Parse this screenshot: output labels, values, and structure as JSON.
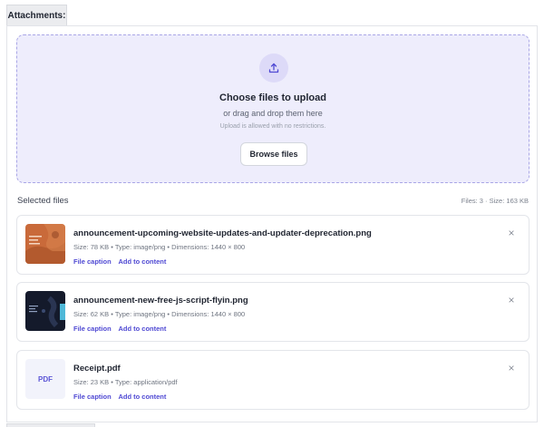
{
  "tab": {
    "label": "Attachments:"
  },
  "dropzone": {
    "icon": "upload-icon",
    "title": "Choose files to upload",
    "subtitle": "or drag and drop them here",
    "note": "Upload is allowed with no restrictions.",
    "browse_label": "Browse files"
  },
  "selected": {
    "title": "Selected files",
    "stats": "Files: 3 · Size: 163 KB"
  },
  "files": [
    {
      "name": "announcement-upcoming-website-updates-and-updater-deprecation.png",
      "meta": "Size: 78 KB • Type: image/png • Dimensions: 1440 × 800",
      "caption_label": "File caption",
      "add_label": "Add to content",
      "close_label": "×",
      "thumb": "image-thumbnail-orange"
    },
    {
      "name": "announcement-new-free-js-script-flyin.png",
      "meta": "Size: 62 KB • Type: image/png • Dimensions: 1440 × 800",
      "caption_label": "File caption",
      "add_label": "Add to content",
      "close_label": "×",
      "thumb": "image-thumbnail-dark"
    },
    {
      "name": "Receipt.pdf",
      "meta": "Size: 23 KB • Type: application/pdf",
      "caption_label": "File caption",
      "add_label": "Add to content",
      "close_label": "×",
      "thumb_label": "PDF"
    }
  ],
  "colors": {
    "accent": "#4f49d3",
    "dropzone_bg": "#eeedfc",
    "dropzone_border": "#a9a6e6"
  }
}
